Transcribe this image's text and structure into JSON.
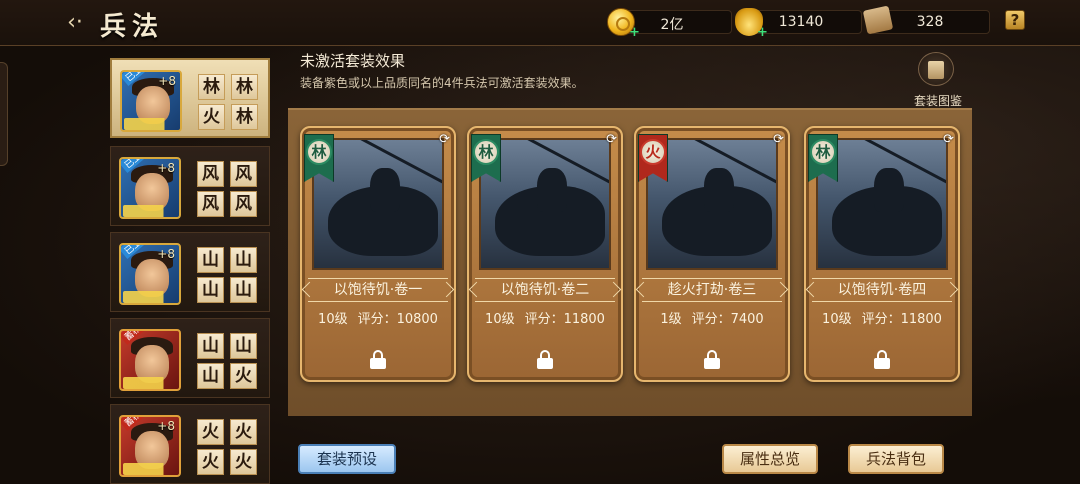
{
  "header": {
    "title": "兵法",
    "back_icon": "back-arrow-icon",
    "resources": [
      {
        "icon": "gold-coin-icon",
        "value": "2亿"
      },
      {
        "icon": "gold-ingot-icon",
        "value": "13140"
      },
      {
        "icon": "scroll-icon",
        "value": "328"
      }
    ],
    "help_label": "?"
  },
  "heroes": [
    {
      "level": "+8",
      "tag": "已上阵",
      "badges": [
        "林",
        "林",
        "火",
        "林"
      ],
      "active": true
    },
    {
      "level": "+8",
      "tag": "已上阵",
      "badges": [
        "风",
        "风",
        "风",
        "风"
      ],
      "active": false
    },
    {
      "level": "+8",
      "tag": "已上阵",
      "badges": [
        "山",
        "山",
        "山",
        "山"
      ],
      "active": false
    },
    {
      "level": "",
      "tag": "蓄积",
      "badges": [
        "山",
        "山",
        "山",
        "火"
      ],
      "active": false
    },
    {
      "level": "+8",
      "tag": "蓄积",
      "badges": [
        "火",
        "火",
        "火",
        "火"
      ],
      "active": false
    }
  ],
  "set_effect": {
    "title": "未激活套装效果",
    "description": "装备紫色或以上品质同名的4件兵法可激活套装效果。",
    "gallery_label": "套装图鉴"
  },
  "cards": [
    {
      "medal": "林",
      "element": "wood",
      "name": "以饱待饥·卷一",
      "level": "10级",
      "score": "评分：10800"
    },
    {
      "medal": "林",
      "element": "wood",
      "name": "以饱待饥·卷二",
      "level": "10级",
      "score": "评分：11800"
    },
    {
      "medal": "火",
      "element": "fire",
      "name": "趁火打劫·卷三",
      "level": "1级",
      "score": "评分：7400"
    },
    {
      "medal": "林",
      "element": "wood",
      "name": "以饱待饥·卷四",
      "level": "10级",
      "score": "评分：11800"
    }
  ],
  "buttons": {
    "preset": "套装预设",
    "overview": "属性总览",
    "bag": "兵法背包"
  }
}
